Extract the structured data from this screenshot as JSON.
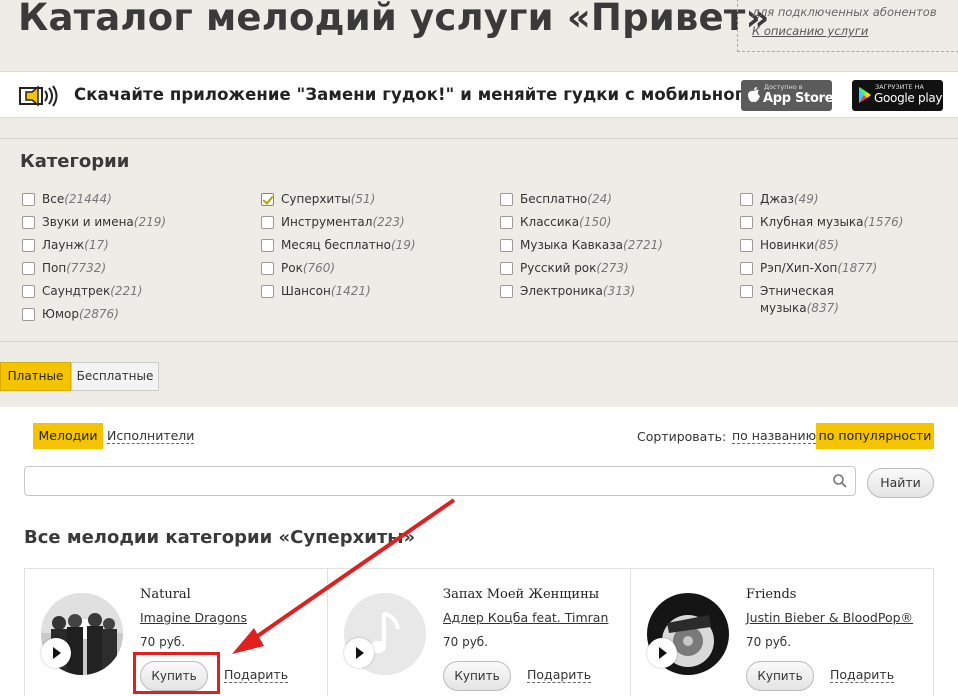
{
  "header": {
    "title": "Каталог мелодий услуги «Привет»",
    "subscriber_note": "для подключенных абонентов",
    "service_link": "К описанию услуги"
  },
  "banner": {
    "text": "Скачайте приложение \"Замени гудок!\" и меняйте гудки с мобильного.",
    "appstore_small": "Доступно в",
    "appstore_big": "App Store",
    "googleplay_small": "ЗАГРУЗИТЕ НА",
    "googleplay_big": "Google play"
  },
  "categories": {
    "title": "Категории",
    "items": [
      {
        "label": "Все",
        "count": "(21444)",
        "checked": false
      },
      {
        "label": "Звуки и имена",
        "count": "(219)",
        "checked": false
      },
      {
        "label": "Лаунж",
        "count": "(17)",
        "checked": false
      },
      {
        "label": "Поп",
        "count": "(7732)",
        "checked": false
      },
      {
        "label": "Саундтрек",
        "count": "(221)",
        "checked": false
      },
      {
        "label": "Юмор",
        "count": "(2876)",
        "checked": false
      },
      {
        "label": "Суперхиты",
        "count": "(51)",
        "checked": true
      },
      {
        "label": "Инструментал",
        "count": "(223)",
        "checked": false
      },
      {
        "label": "Месяц бесплатно",
        "count": "(19)",
        "checked": false
      },
      {
        "label": "Рок",
        "count": "(760)",
        "checked": false
      },
      {
        "label": "Шансон",
        "count": "(1421)",
        "checked": false
      },
      {
        "label": "Бесплатно",
        "count": "(24)",
        "checked": false
      },
      {
        "label": "Классика",
        "count": "(150)",
        "checked": false
      },
      {
        "label": "Музыка Кавказа",
        "count": "(2721)",
        "checked": false
      },
      {
        "label": "Русский рок",
        "count": "(273)",
        "checked": false
      },
      {
        "label": "Электроника",
        "count": "(313)",
        "checked": false
      },
      {
        "label": "Джаз",
        "count": "(49)",
        "checked": false
      },
      {
        "label": "Клубная музыка",
        "count": "(1576)",
        "checked": false
      },
      {
        "label": "Новинки",
        "count": "(85)",
        "checked": false
      },
      {
        "label": "Рэп/Хип-Хоп",
        "count": "(1877)",
        "checked": false
      },
      {
        "label": "Этническая",
        "label2": "музыка",
        "count": "(837)",
        "checked": false
      }
    ]
  },
  "pricing_tabs": {
    "paid": "Платные",
    "free": "Бесплатные"
  },
  "list_tabs": {
    "melodies": "Мелодии",
    "artists": "Исполнители"
  },
  "sort": {
    "label": "Сортировать:",
    "by_name": "по названию",
    "by_popularity": "по популярности"
  },
  "search": {
    "value": "",
    "placeholder": "",
    "button": "Найти"
  },
  "section_title": "Все мелодии категории «Суперхиты»",
  "melodies": [
    {
      "title": "Natural",
      "artist": "Imagine Dragons",
      "price": "70 руб.",
      "buy": "Купить",
      "gift": "Подарить"
    },
    {
      "title": "Запах Моей Женщины",
      "artist": "Адлер Коцба feat. Timran",
      "price": "70 руб.",
      "buy": "Купить",
      "gift": "Подарить"
    },
    {
      "title": "Friends",
      "artist": "Justin Bieber & BloodPop®",
      "price": "70 руб.",
      "buy": "Купить",
      "gift": "Подарить"
    }
  ],
  "colors": {
    "accent": "#f4c400",
    "annotation": "#e01f1f"
  }
}
